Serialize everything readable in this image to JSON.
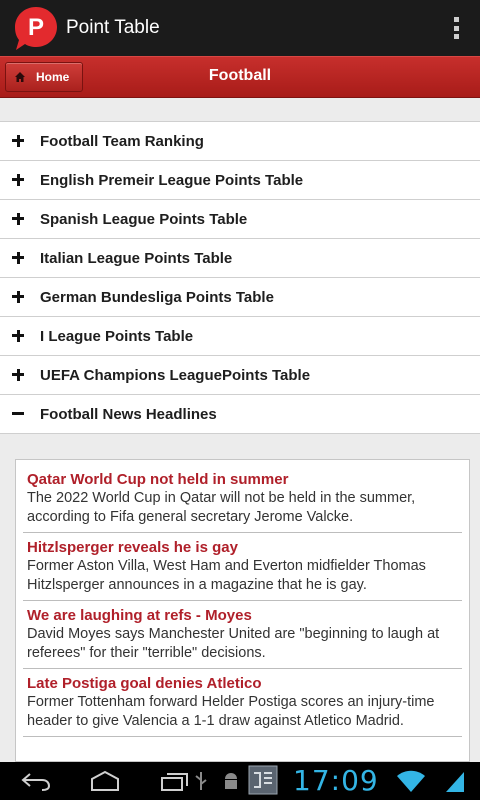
{
  "app": {
    "title": "Point Table",
    "logo_letter": "P"
  },
  "header": {
    "home_label": "Home",
    "title": "Football"
  },
  "menu": {
    "items": [
      {
        "label": "Football Team Ranking",
        "sign": "plus"
      },
      {
        "label": "English Premeir League Points Table",
        "sign": "plus"
      },
      {
        "label": "Spanish League Points Table",
        "sign": "plus"
      },
      {
        "label": "Italian League Points Table",
        "sign": "plus"
      },
      {
        "label": "German Bundesliga Points Table",
        "sign": "plus"
      },
      {
        "label": "I League Points Table",
        "sign": "plus"
      },
      {
        "label": "UEFA Champions LeaguePoints Table",
        "sign": "plus"
      },
      {
        "label": "Football News Headlines",
        "sign": "minus"
      }
    ]
  },
  "news": {
    "items": [
      {
        "title": "Qatar World Cup not held in summer",
        "text": "The 2022 World Cup in Qatar will not be held in the summer, according to Fifa general secretary Jerome Valcke."
      },
      {
        "title": "Hitzlsperger reveals he is gay",
        "text": "Former Aston Villa, West Ham and Everton midfielder Thomas Hitzlsperger announces in a magazine that he is gay."
      },
      {
        "title": "We are laughing at refs - Moyes",
        "text": "David Moyes says Manchester United are \"beginning to laugh at referees\" for their \"terrible\" decisions."
      },
      {
        "title": "Late Postiga goal denies Atletico",
        "text": "Former Tottenham forward Helder Postiga scores an injury-time header to give Valencia a 1-1 draw against Atletico Madrid."
      }
    ]
  },
  "status_bar": {
    "clock": "17:09",
    "icons": [
      "back-icon",
      "home-icon",
      "recent-apps-icon",
      "usb-icon",
      "android-debug-icon",
      "notification-app-icon",
      "wifi-icon",
      "signal-icon"
    ]
  },
  "colors": {
    "accent_red": "#b52521",
    "news_title": "#b0202a",
    "clock": "#33b5e5"
  }
}
